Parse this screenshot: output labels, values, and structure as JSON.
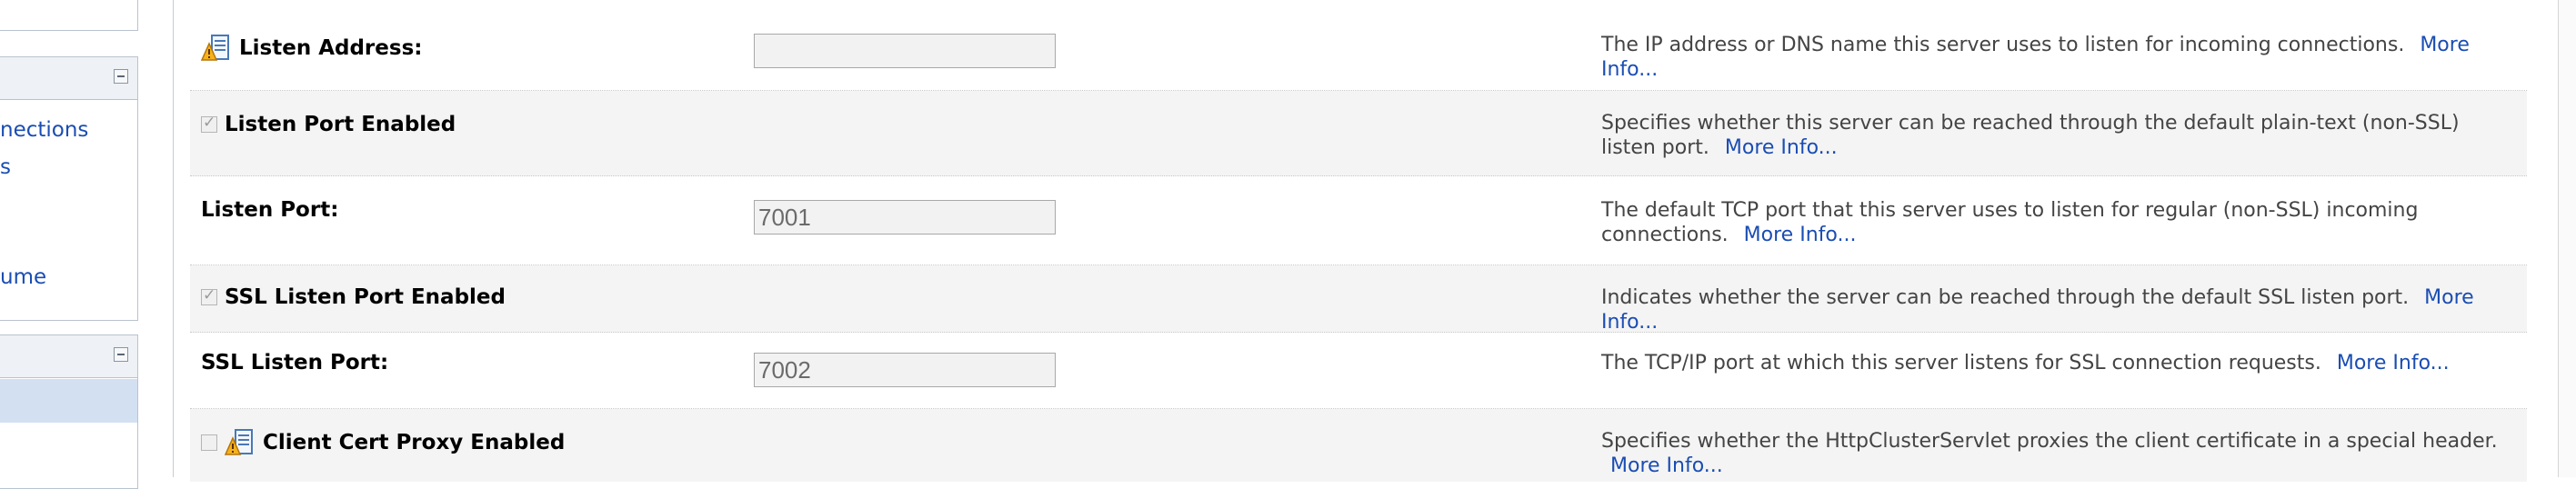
{
  "sidebar": {
    "panel_a_links": [
      "nections",
      "s",
      "ume"
    ]
  },
  "rows": [
    {
      "label": "Listen Address:",
      "has_warn_icon": true,
      "input_value": "",
      "description": "The IP address or DNS name this server uses to listen for incoming connections.",
      "more_info": "More Info..."
    },
    {
      "label": "Listen Port Enabled",
      "checkbox": "checked",
      "description": "Specifies whether this server can be reached through the default plain-text (non-SSL) listen port.",
      "more_info": "More Info..."
    },
    {
      "label": "Listen Port:",
      "input_value": "7001",
      "description": "The default TCP port that this server uses to listen for regular (non-SSL) incoming connections.",
      "more_info": "More Info..."
    },
    {
      "label": "SSL Listen Port Enabled",
      "checkbox": "checked",
      "description": "Indicates whether the server can be reached through the default SSL listen port.",
      "more_info": "More Info..."
    },
    {
      "label": "SSL Listen Port:",
      "input_value": "7002",
      "description": "The TCP/IP port at which this server listens for SSL connection requests.",
      "more_info": "More Info..."
    },
    {
      "label": "Client Cert Proxy Enabled",
      "checkbox": "unchecked",
      "has_warn_icon": true,
      "description": "Specifies whether the HttpClusterServlet proxies the client certificate in a special header.",
      "more_info": "More Info..."
    }
  ],
  "colors": {
    "link": "#1a4db3",
    "row_alt_bg": "#f4f4f4",
    "selected_item_bg": "#d3e0f2"
  },
  "icons": {
    "warning": "restart-required-warning-icon",
    "collapse": "collapse-icon"
  }
}
